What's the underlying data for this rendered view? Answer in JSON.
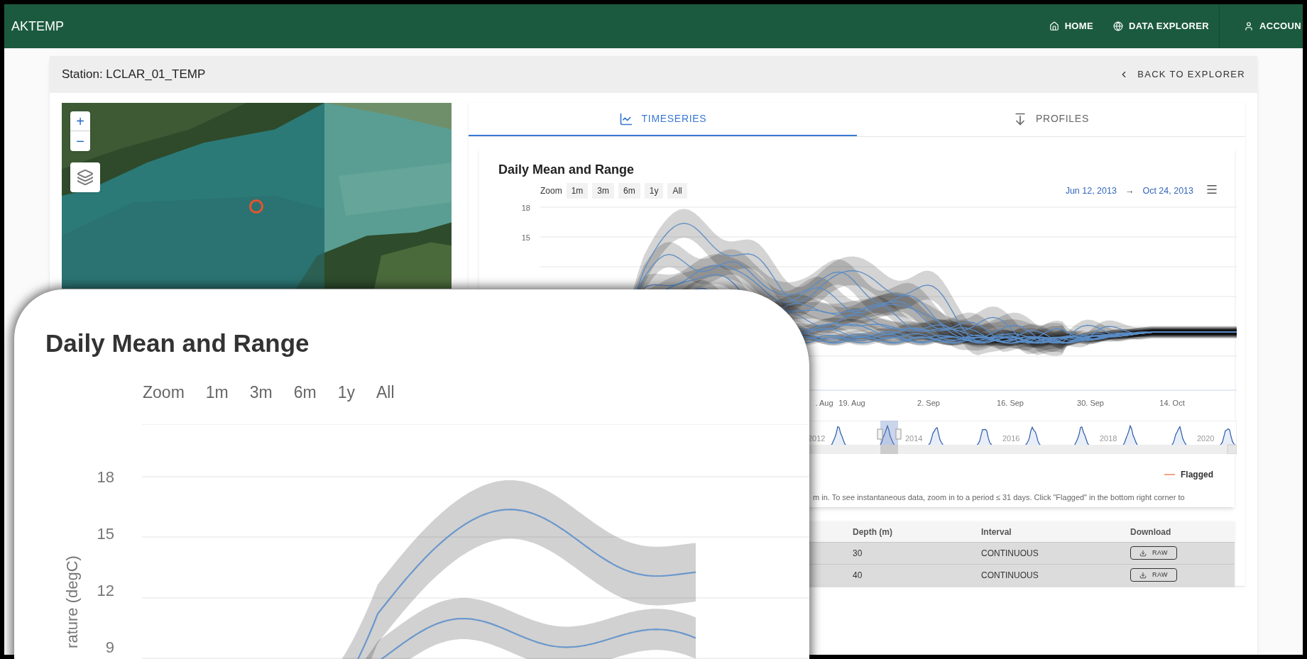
{
  "app": {
    "title": "AKTEMP",
    "nav": [
      {
        "label": "HOME"
      },
      {
        "label": "DATA EXPLORER"
      },
      {
        "label": "ACCOUN"
      }
    ]
  },
  "station": {
    "title": "Station: LCLAR_01_TEMP",
    "back": "BACK TO EXPLORER"
  },
  "map": {
    "zoom_in": "+",
    "zoom_out": "−"
  },
  "tabs": [
    {
      "label": "TIMESERIES",
      "selected": true
    },
    {
      "label": "PROFILES",
      "selected": false
    }
  ],
  "chart": {
    "title": "Daily Mean and Range",
    "zoom_label": "Zoom",
    "zoom_buttons": [
      "1m",
      "3m",
      "6m",
      "1y",
      "All"
    ],
    "range_start": "Jun 12, 2013",
    "range_sep": "→",
    "range_end": "Oct 24, 2013",
    "yticks": [
      "18",
      "15"
    ],
    "xticks": [
      ". Aug",
      "19. Aug",
      "2. Sep",
      "16. Sep",
      "30. Sep",
      "14. Oct"
    ],
    "navigator_years": [
      "2012",
      "2014",
      "2016",
      "2018",
      "2020"
    ],
    "legend": [
      {
        "label": "Flagged",
        "color": "#f4a582"
      }
    ],
    "note": "m in. To see instantaneous data, zoom in to a period ≤ 31 days. Click \"Flagged\" in the bottom right corner to"
  },
  "table": {
    "columns": [
      "Depth (m)",
      "Interval",
      "Download"
    ],
    "rows": [
      {
        "depth": "30",
        "interval": "CONTINUOUS",
        "download": "RAW"
      },
      {
        "depth": "40",
        "interval": "CONTINUOUS",
        "download": "RAW"
      }
    ]
  },
  "callout": {
    "title": "Daily Mean and Range",
    "zoom_label": "Zoom",
    "zoom_buttons": [
      "1m",
      "3m",
      "6m",
      "1y",
      "All"
    ],
    "yticks": [
      "18",
      "15",
      "12",
      "9"
    ],
    "ylabel": "rature (degC)"
  }
}
